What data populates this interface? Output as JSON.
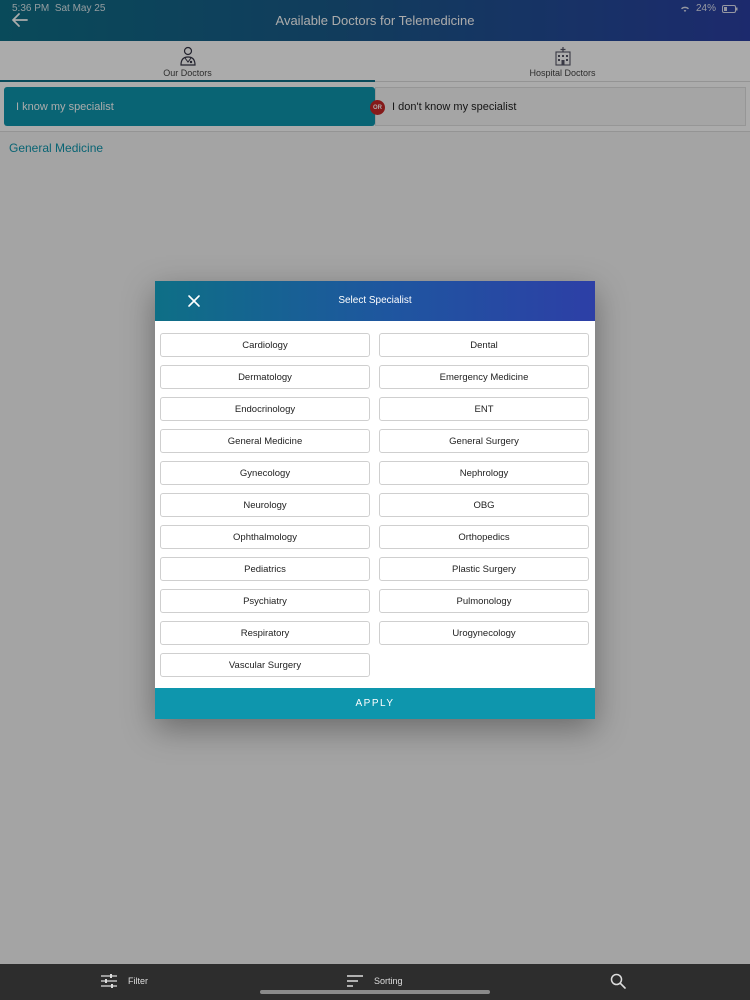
{
  "status": {
    "time": "5:36 PM",
    "date": "Sat May 25",
    "battery": "24%"
  },
  "header": {
    "title": "Available Doctors for Telemedicine"
  },
  "tabs": [
    {
      "label": "Our Doctors",
      "icon": "doctor-icon"
    },
    {
      "label": "Hospital Doctors",
      "icon": "hospital-icon"
    }
  ],
  "segments": {
    "left": "I know my specialist",
    "right": "I don't know my specialist",
    "or": "OR"
  },
  "selected_specialist": "General Medicine",
  "modal": {
    "title": "Select Specialist",
    "apply_label": "APPLY",
    "specialists": [
      "Cardiology",
      "Dental",
      "Dermatology",
      "Emergency Medicine",
      "Endocrinology",
      "ENT",
      "General Medicine",
      "General Surgery",
      "Gynecology",
      "Nephrology",
      "Neurology",
      "OBG",
      "Ophthalmology",
      "Orthopedics",
      "Pediatrics",
      "Plastic Surgery",
      "Psychiatry",
      "Pulmonology",
      "Respiratory",
      "Urogynecology",
      "Vascular Surgery"
    ]
  },
  "bottom_bar": {
    "filter_label": "Filter",
    "sorting_label": "Sorting"
  },
  "colors": {
    "accent": "#0e96ad",
    "header_start": "#0e6f86",
    "header_end": "#2b3fa3",
    "or_badge": "#c62828"
  }
}
